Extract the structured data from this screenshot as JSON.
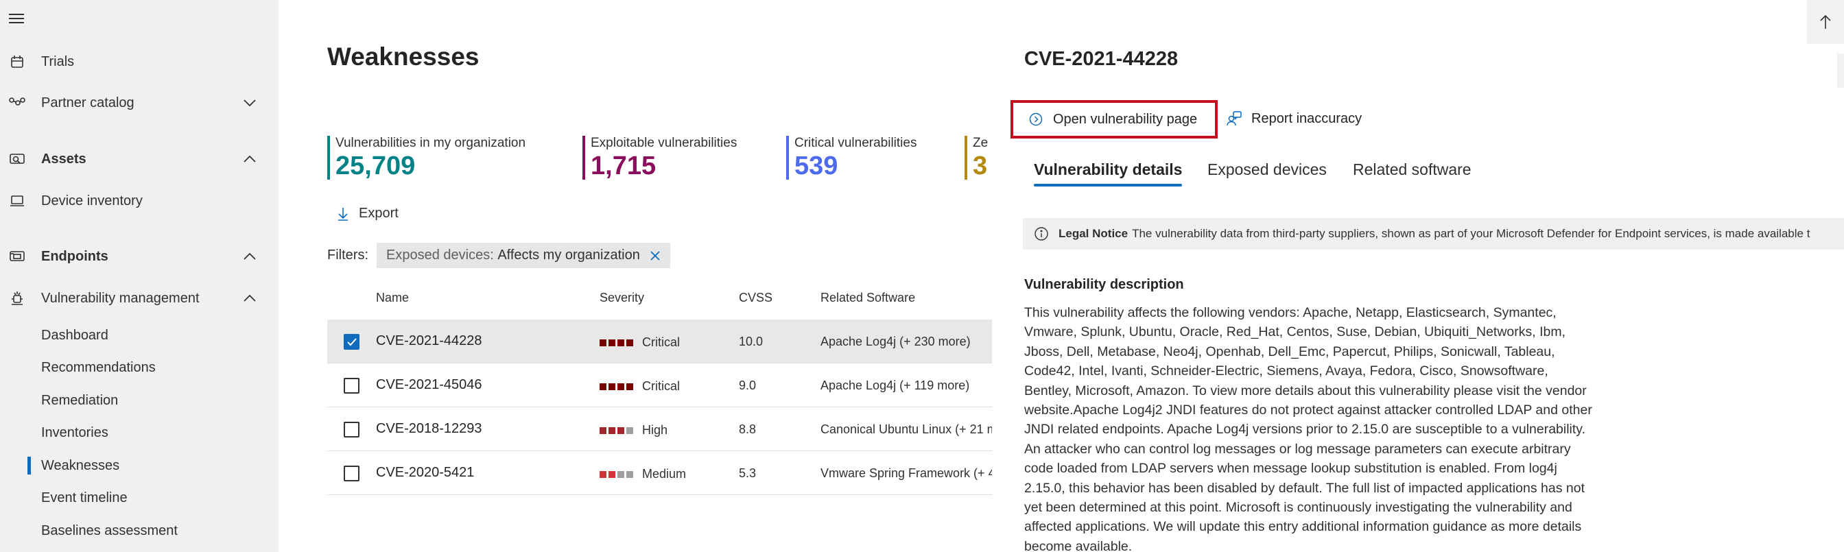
{
  "nav": {
    "items": [
      {
        "label": "Trials"
      },
      {
        "label": "Partner catalog"
      },
      {
        "label": "Assets"
      },
      {
        "label": "Device inventory"
      },
      {
        "label": "Endpoints"
      },
      {
        "label": "Vulnerability management"
      }
    ],
    "sub_items": [
      {
        "label": "Dashboard"
      },
      {
        "label": "Recommendations"
      },
      {
        "label": "Remediation"
      },
      {
        "label": "Inventories"
      },
      {
        "label": "Weaknesses"
      },
      {
        "label": "Event timeline"
      },
      {
        "label": "Baselines assessment"
      }
    ]
  },
  "main": {
    "title": "Weaknesses",
    "metrics": [
      {
        "label": "Vulnerabilities in my organization",
        "value": "25,709",
        "color": "#038387"
      },
      {
        "label": "Exploitable vulnerabilities",
        "value": "1,715",
        "color": "#8a0e5c"
      },
      {
        "label": "Critical vulnerabilities",
        "value": "539",
        "color": "#4f6bed"
      },
      {
        "label": "Ze",
        "value": "3",
        "color": "#b28a10"
      }
    ],
    "export_label": "Export",
    "filters_label": "Filters:",
    "filter_key": "Exposed devices:",
    "filter_value": "Affects my organization",
    "columns": {
      "name": "Name",
      "severity": "Severity",
      "cvss": "CVSS",
      "software": "Related Software"
    },
    "rows": [
      {
        "name": "CVE-2021-44228",
        "severity": "Critical",
        "cvss": "10.0",
        "software": "Apache Log4j (+ 230 more)"
      },
      {
        "name": "CVE-2021-45046",
        "severity": "Critical",
        "cvss": "9.0",
        "software": "Apache Log4j (+ 119 more)"
      },
      {
        "name": "CVE-2018-12293",
        "severity": "High",
        "cvss": "8.8",
        "software": "Canonical Ubuntu Linux (+ 21 m"
      },
      {
        "name": "CVE-2020-5421",
        "severity": "Medium",
        "cvss": "5.3",
        "software": "Vmware Spring Framework (+ 4"
      }
    ]
  },
  "panel": {
    "title": "CVE-2021-44228",
    "open_page_label": "Open vulnerability page",
    "report_label": "Report inaccuracy",
    "tabs": [
      {
        "label": "Vulnerability details"
      },
      {
        "label": "Exposed devices"
      },
      {
        "label": "Related software"
      }
    ],
    "notice_label": "Legal Notice",
    "notice_text": "The vulnerability data from third-party suppliers, shown as part of your Microsoft Defender for Endpoint services, is made available t",
    "desc_title": "Vulnerability description",
    "desc_body": "This vulnerability affects the following vendors: Apache, Netapp, Elasticsearch, Symantec, Vmware, Splunk, Ubuntu, Oracle, Red_Hat, Centos, Suse, Debian, Ubiquiti_Networks, Ibm, Jboss, Dell, Metabase, Neo4j, Openhab, Dell_Emc, Papercut, Philips, Sonicwall, Tableau, Code42, Intel, Ivanti, Schneider-Electric, Siemens, Avaya, Fedora, Cisco, Snowsoftware, Bentley, Microsoft, Amazon. To view more details about this vulnerability please visit the vendor website.Apache Log4j2 JNDI features do not protect against attacker controlled LDAP and other JNDI related endpoints. Apache Log4j versions prior to 2.15.0 are susceptible to a vulnerability. An attacker who can control log messages or log message parameters can execute arbitrary code loaded from LDAP servers when message lookup substitution is enabled. From log4j 2.15.0, this behavior has been disabled by default. The full list of impacted applications has not yet been determined at this point. Microsoft is continuously investigating the vulnerability and affected applications. We will update this entry additional information guidance as more details become available."
  },
  "colors": {
    "accent": "#0f6cbd",
    "highlight_box": "#c50f1f",
    "sev_critical": "#7a0000",
    "sev_high": "#a4262c",
    "sev_medium": "#d13438",
    "sev_empty": "#a19f9d"
  },
  "icons": [
    "menu-icon",
    "trials-icon",
    "partner-catalog-icon",
    "assets-icon",
    "device-inventory-icon",
    "endpoints-icon",
    "vulnerability-management-icon",
    "chevron-down-icon",
    "chevron-up-icon",
    "export-icon",
    "close-icon",
    "checkmark-icon",
    "open-page-icon",
    "report-icon",
    "info-icon",
    "arrow-up-icon"
  ]
}
